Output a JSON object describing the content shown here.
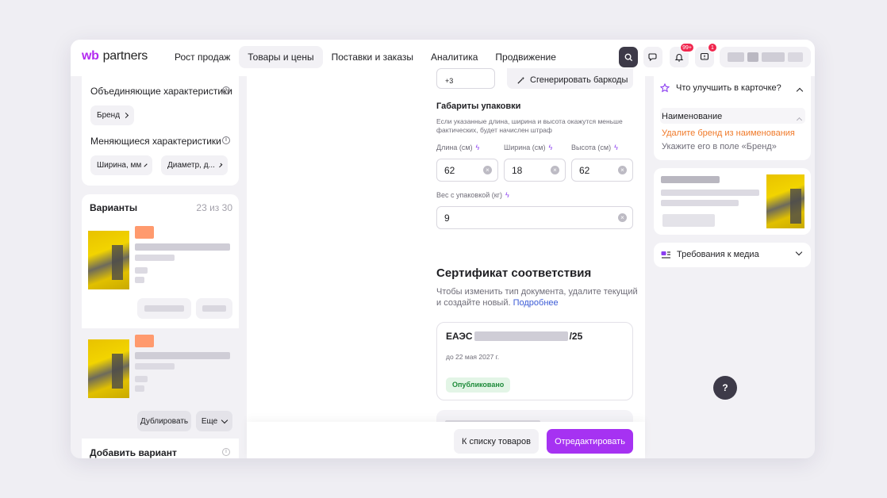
{
  "header": {
    "logo_wb": "wb",
    "logo_partners": "partners",
    "nav": [
      {
        "label": "Рост продаж"
      },
      {
        "label": "Товары и цены",
        "active": true
      },
      {
        "label": "Поставки и заказы"
      },
      {
        "label": "Аналитика"
      },
      {
        "label": "Продвижение"
      }
    ],
    "notifications_badge": "99+",
    "feedback_badge": "1"
  },
  "left": {
    "unifying_title": "Объединяющие характеристики",
    "brand_chip": "Бренд",
    "changing_title": "Меняющиеся характеристики",
    "width_chip": "Ширина, мм",
    "diameter_chip": "Диаметр, д...",
    "variants_title": "Варианты",
    "variants_count": "23 из 30",
    "duplicate_label": "Дублировать",
    "more_label": "Еще",
    "add_variant": "Добавить вариант"
  },
  "main": {
    "barcode_count": "+3",
    "generate_barcodes": "Сгенерировать баркоды",
    "package_title": "Габариты упаковки",
    "package_hint": "Если указанные длина, ширина и высота окажутся меньше фактических, будет начислен штраф",
    "length_label": "Длина (см)",
    "length_value": "62",
    "width_label": "Ширина (см)",
    "width_value": "18",
    "height_label": "Высота (см)",
    "height_value": "62",
    "weight_label": "Вес с упаковкой (кг)",
    "weight_value": "9",
    "cert_title": "Сертификат соответствия",
    "cert_hint": "Чтобы изменить тип документа, удалите текущий и создайте новый.",
    "cert_more": "Подробнее",
    "cert_number_prefix": "ЕАЭС",
    "cert_number_suffix": "/25",
    "cert_valid": "до 22 мая 2027 г.",
    "cert_status": "Опубликовано"
  },
  "footer": {
    "back_label": "К списку товаров",
    "edit_label": "Отредактировать"
  },
  "right": {
    "improve_title": "Что улучшить в карточке?",
    "name_section": "Наименование",
    "remove_brand": "Удалите бренд из наименования",
    "brand_hint": "Укажите его в поле «Бренд»",
    "media_title": "Требования к медиа"
  },
  "help_label": "?",
  "colors": {
    "accent": "#a632f2",
    "warning": "#f07a2a",
    "link": "#3b5bd6",
    "success": "#1e8b3a"
  }
}
